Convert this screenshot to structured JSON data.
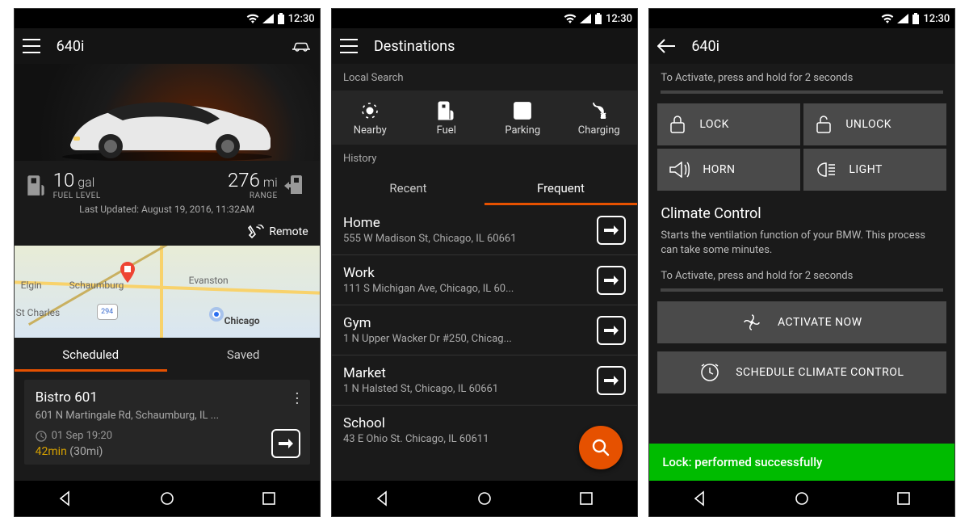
{
  "statusbar": {
    "time": "12:30"
  },
  "s1": {
    "title": "640i",
    "fuel_value": "10",
    "fuel_unit": "gal",
    "fuel_label": "FUEL LEVEL",
    "range_value": "276",
    "range_unit": "mi",
    "range_label": "RANGE",
    "last_updated": "Last Updated: August 19, 2016, 11:32AM",
    "remote_label": "Remote",
    "tabs": {
      "scheduled": "Scheduled",
      "saved": "Saved"
    },
    "card": {
      "title": "Bistro 601",
      "address": "601 N Martingale Rd, Schaumburg, IL ...",
      "depart": "01 Sep 19:20",
      "duration": "42min",
      "distance": "(30mi)"
    },
    "map_labels": {
      "elgin": "Elgin",
      "schaumburg": "Schaumburg",
      "evanston": "Evanston",
      "stcharles": "St Charles",
      "chicago": "Chicago"
    }
  },
  "s2": {
    "title": "Destinations",
    "local_search": "Local Search",
    "history": "History",
    "icons": {
      "nearby": "Nearby",
      "fuel": "Fuel",
      "parking": "Parking",
      "charging": "Charging"
    },
    "tabs": {
      "recent": "Recent",
      "frequent": "Frequent"
    },
    "items": [
      {
        "name": "Home",
        "addr": "555 W Madison St, Chicago, IL 60661"
      },
      {
        "name": "Work",
        "addr": "111 S Michigan Ave, Chicago, IL 60..."
      },
      {
        "name": "Gym",
        "addr": "1 N Upper Wacker Dr #250, Chicag..."
      },
      {
        "name": "Market",
        "addr": "1 N Halsted St, Chicago, IL 60661"
      },
      {
        "name": "School",
        "addr": "43 E Ohio St. Chicago, IL 60611"
      }
    ]
  },
  "s3": {
    "title": "640i",
    "hint": "To Activate, press and hold for 2 seconds",
    "buttons": {
      "lock": "LOCK",
      "unlock": "UNLOCK",
      "horn": "HORN",
      "light": "LIGHT"
    },
    "climate_title": "Climate Control",
    "climate_desc": "Starts the ventilation function of your BMW. This process can take some minutes.",
    "activate": "ACTIVATE NOW",
    "schedule": "SCHEDULE CLIMATE CONTROL",
    "toast": "Lock: performed successfully"
  }
}
